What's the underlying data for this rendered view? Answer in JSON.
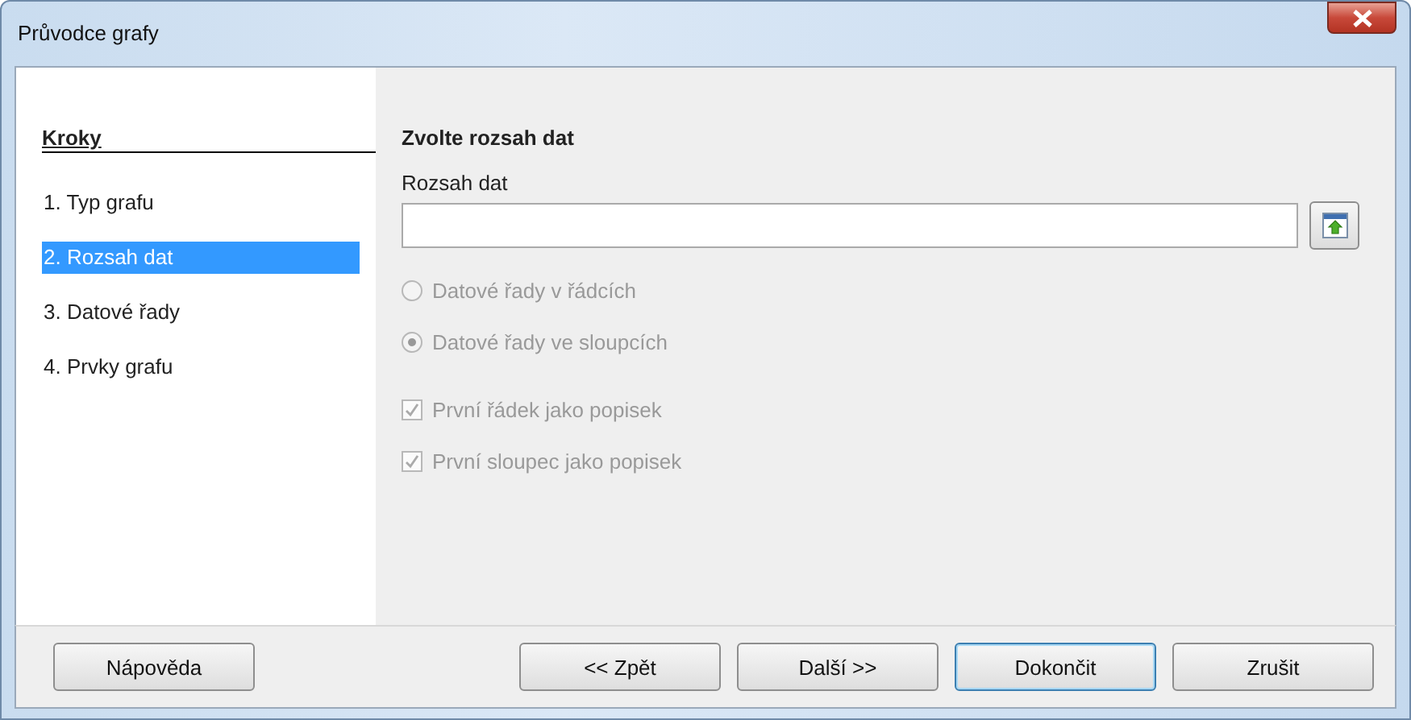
{
  "window": {
    "title": "Průvodce grafy"
  },
  "sidebar": {
    "title": "Kroky",
    "items": [
      {
        "label": "1. Typ grafu",
        "selected": false
      },
      {
        "label": "2. Rozsah dat",
        "selected": true
      },
      {
        "label": "3. Datové řady",
        "selected": false
      },
      {
        "label": "4. Prvky grafu",
        "selected": false
      }
    ]
  },
  "content": {
    "heading": "Zvolte rozsah dat",
    "range_label": "Rozsah dat",
    "radios": [
      {
        "label": "Datové řady v řádcích",
        "selected": false,
        "disabled": true
      },
      {
        "label": "Datové řady ve sloupcích",
        "selected": true,
        "disabled": true
      }
    ],
    "checkboxes": [
      {
        "label": "První řádek jako popisek",
        "checked": true,
        "disabled": true
      },
      {
        "label": "První sloupec jako popisek",
        "checked": true,
        "disabled": true
      }
    ]
  },
  "buttons": [
    {
      "label": "Nápověda",
      "focused": false
    },
    {
      "label": "<< Zpět",
      "focused": false
    },
    {
      "label": "Další >>",
      "focused": false
    },
    {
      "label": "Dokončit",
      "focused": true
    },
    {
      "label": "Zrušit",
      "focused": false
    }
  ]
}
